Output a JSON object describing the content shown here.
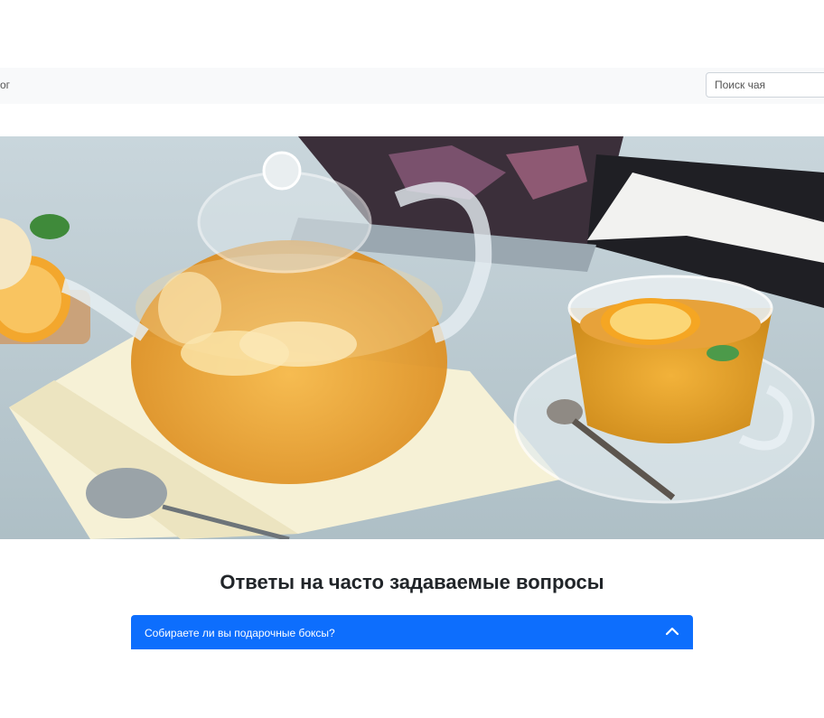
{
  "navbar": {
    "link_partial": "ог",
    "search": {
      "placeholder": "Поиск чая",
      "value": ""
    }
  },
  "hero": {
    "icon": "teapot-hero-image"
  },
  "faq": {
    "title": "Ответы на часто задаваемые вопросы",
    "items": [
      {
        "question": "Собираете ли вы подарочные боксы?",
        "expanded": true
      }
    ]
  },
  "colors": {
    "accent": "#0d6efd",
    "navbar_bg": "#f8f9fa",
    "tea": "#e8a63a"
  }
}
